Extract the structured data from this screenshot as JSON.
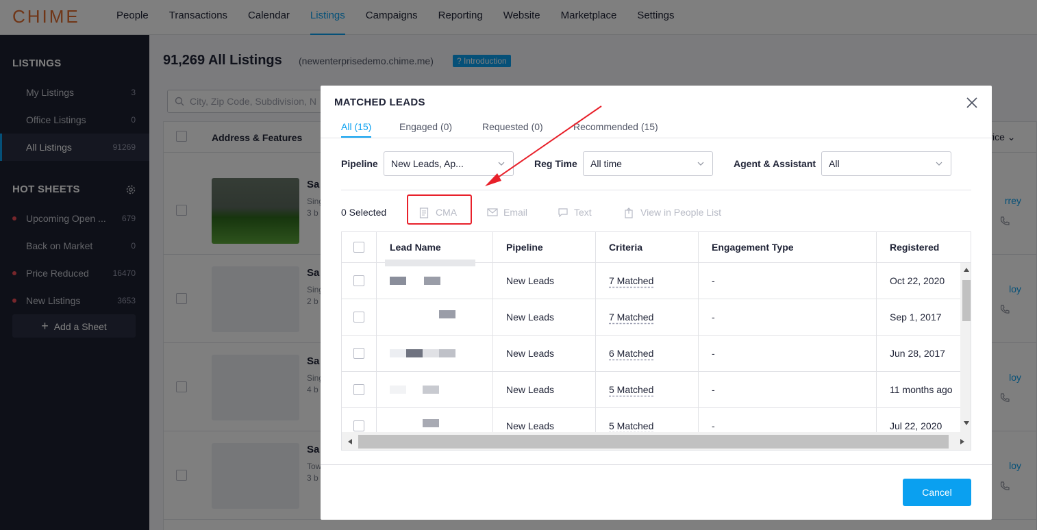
{
  "nav": {
    "logo": "CHIME",
    "links": [
      "People",
      "Transactions",
      "Calendar",
      "Listings",
      "Campaigns",
      "Reporting",
      "Website",
      "Marketplace",
      "Settings"
    ],
    "active_index": 3
  },
  "sidebar": {
    "listings_heading": "LISTINGS",
    "items": [
      {
        "label": "My Listings",
        "count": "3"
      },
      {
        "label": "Office Listings",
        "count": "0"
      },
      {
        "label": "All Listings",
        "count": "91269"
      }
    ],
    "hot_heading": "HOT SHEETS",
    "hot_items": [
      {
        "label": "Upcoming Open ...",
        "count": "679",
        "dot": true
      },
      {
        "label": "Back on Market",
        "count": "0",
        "dot": false
      },
      {
        "label": "Price Reduced",
        "count": "16470",
        "dot": true
      },
      {
        "label": "New Listings",
        "count": "3653",
        "dot": true
      }
    ],
    "add_sheet": "Add a Sheet"
  },
  "main": {
    "title": "91,269 All Listings",
    "domain": "(newenterprisedemo.chime.me)",
    "intro": "Introduction",
    "search_placeholder": "City, Zip Code, Subdivision, N",
    "col_address": "Address & Features",
    "col_price": "Price",
    "rows": [
      {
        "title": "Sa",
        "line1": "Sing",
        "line2": "3 b",
        "agent": "rrey"
      },
      {
        "title": "Sa",
        "line1": "Sing",
        "line2": "2 b",
        "agent": "loy"
      },
      {
        "title": "Sa",
        "line1": "Sing",
        "line2": "4 b",
        "agent": "loy"
      },
      {
        "title": "Sa",
        "line1": "Tow",
        "line2": "3 b",
        "agent": "loy"
      }
    ]
  },
  "modal": {
    "title": "MATCHED LEADS",
    "tabs": [
      "All (15)",
      "Engaged (0)",
      "Requested (0)",
      "Recommended (15)"
    ],
    "filters": {
      "pipeline_label": "Pipeline",
      "pipeline_value": "New Leads, Ap...",
      "regtime_label": "Reg Time",
      "regtime_value": "All time",
      "agent_label": "Agent & Assistant",
      "agent_value": "All"
    },
    "selected_text": "0 Selected",
    "actions": [
      "CMA",
      "Email",
      "Text",
      "View in People List"
    ],
    "columns": [
      "Lead Name",
      "Pipeline",
      "Criteria",
      "Engagement Type",
      "Registered"
    ],
    "rows": [
      {
        "pipeline": "New Leads",
        "criteria": "7 Matched",
        "engagement": "-",
        "registered": "Oct 22, 2020"
      },
      {
        "pipeline": "New Leads",
        "criteria": "7 Matched",
        "engagement": "-",
        "registered": "Sep 1, 2017"
      },
      {
        "pipeline": "New Leads",
        "criteria": "6 Matched",
        "engagement": "-",
        "registered": "Jun 28, 2017"
      },
      {
        "pipeline": "New Leads",
        "criteria": "5 Matched",
        "engagement": "-",
        "registered": "11 months ago"
      },
      {
        "pipeline": "New Leads",
        "criteria": "5 Matched",
        "engagement": "-",
        "registered": "Jul 22, 2020"
      }
    ],
    "cancel": "Cancel"
  },
  "colors": {
    "accent": "#0aa0f0",
    "highlight": "#e8202a",
    "sidebar_bg": "#1c2030",
    "logo": "#e06a2c"
  }
}
